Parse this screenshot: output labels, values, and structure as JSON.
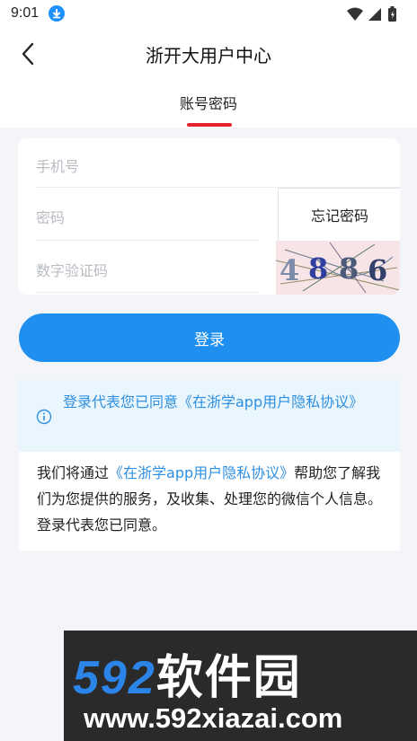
{
  "status_bar": {
    "time": "9:01",
    "download_icon": "download-icon"
  },
  "header": {
    "title": "浙开大用户中心",
    "back_icon": "chevron-left-icon"
  },
  "tabs": [
    {
      "label": "账号密码",
      "active": true
    }
  ],
  "form": {
    "phone_placeholder": "手机号",
    "password_placeholder": "密码",
    "forgot_label": "忘记密码",
    "captcha_placeholder": "数字验证码",
    "captcha_text": "4886"
  },
  "login_button": {
    "label": "登录"
  },
  "notice": {
    "agree_text": "登录代表您已同意《在浙学app用户隐私协议》",
    "body_prefix": "我们将通过",
    "policy_link": "《在浙学app用户隐私协议》",
    "body_suffix": "帮助您了解我们为您提供的服务，及收集、处理您的微信个人信息。登录代表您已同意。"
  },
  "watermark": {
    "brand_number": "592",
    "brand_name": "软件园",
    "url": "www.592xiazai.com"
  },
  "colors": {
    "primary": "#2090f0",
    "link": "#2f8fe0",
    "tab_indicator": "#e8232c",
    "notice_bg": "#e9f6fd"
  }
}
